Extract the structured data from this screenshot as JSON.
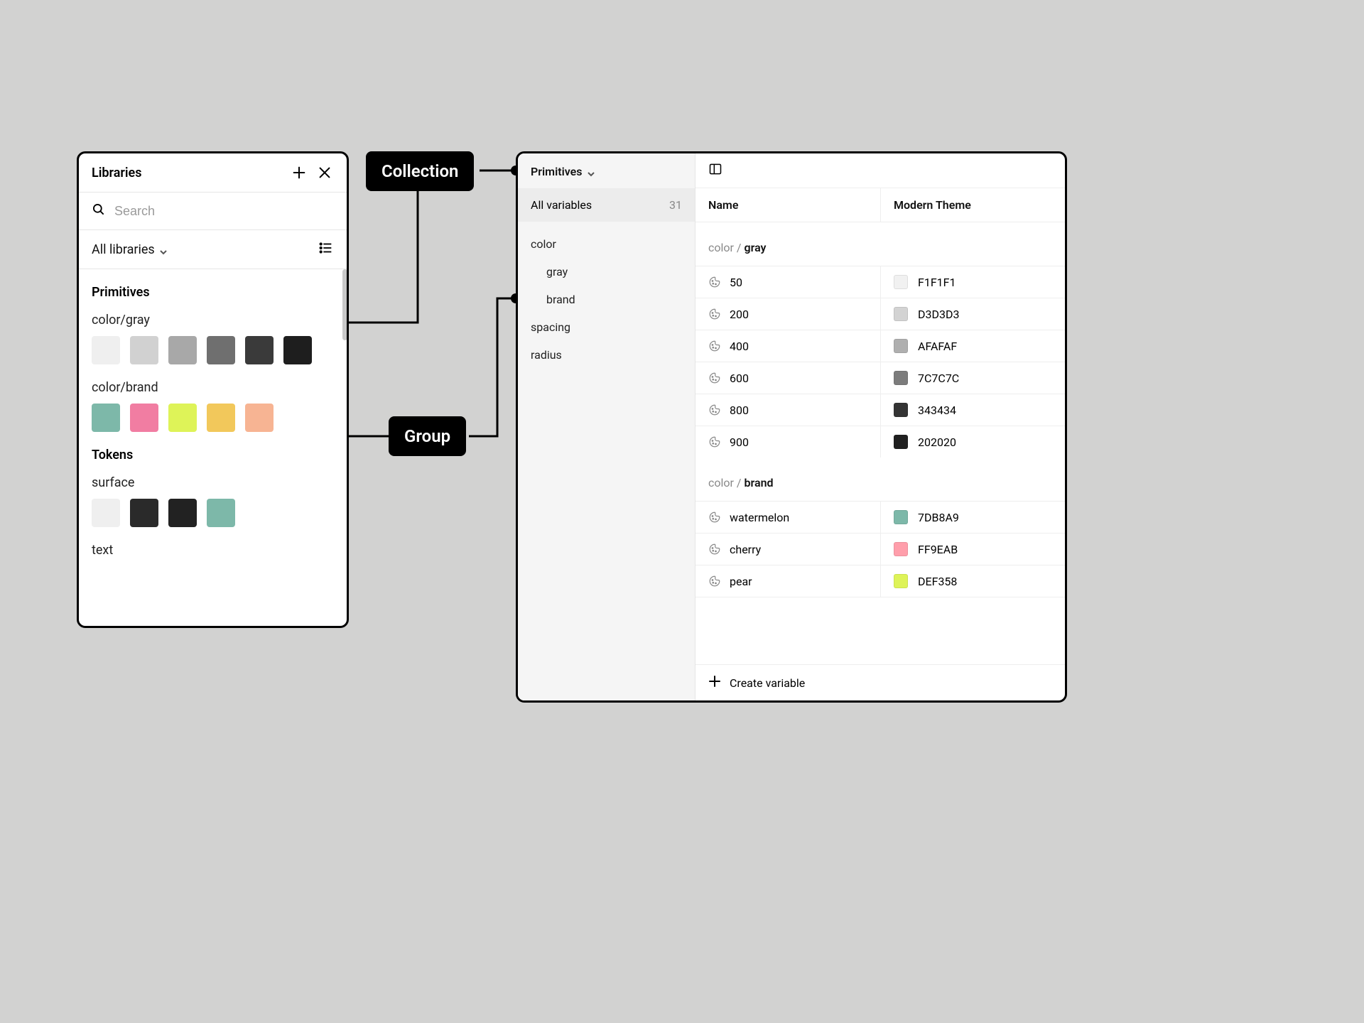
{
  "callouts": {
    "collection": "Collection",
    "group": "Group"
  },
  "libraries": {
    "title": "Libraries",
    "search_placeholder": "Search",
    "filter_label": "All libraries",
    "sections": {
      "primitives": {
        "title": "Primitives",
        "groups": [
          {
            "name": "color/gray",
            "swatches": [
              "#efefef",
              "#d1d1d1",
              "#a8a8a8",
              "#6f6f6f",
              "#3a3a3a",
              "#1e1e1e"
            ]
          },
          {
            "name": "color/brand",
            "swatches": [
              "#7db8a9",
              "#f17da2",
              "#def358",
              "#f2c85b",
              "#f7b493"
            ]
          }
        ]
      },
      "tokens": {
        "title": "Tokens",
        "groups": [
          {
            "name": "surface",
            "swatches": [
              "#efefef",
              "#2a2a2a",
              "#222222",
              "#7db8a9"
            ]
          },
          {
            "name": "text",
            "swatches": []
          }
        ]
      }
    }
  },
  "variables": {
    "collection_name": "Primitives",
    "all_variables_label": "All variables",
    "all_variables_count": "31",
    "tree": [
      {
        "label": "color",
        "children": [
          "gray",
          "brand"
        ]
      },
      {
        "label": "spacing",
        "children": []
      },
      {
        "label": "radius",
        "children": []
      }
    ],
    "columns": {
      "name": "Name",
      "mode": "Modern Theme"
    },
    "groups": [
      {
        "path_prefix": "color / ",
        "path_name": "gray",
        "rows": [
          {
            "name": "50",
            "hex": "F1F1F1",
            "swatch": "#f1f1f1"
          },
          {
            "name": "200",
            "hex": "D3D3D3",
            "swatch": "#d3d3d3"
          },
          {
            "name": "400",
            "hex": "AFAFAF",
            "swatch": "#afafaf"
          },
          {
            "name": "600",
            "hex": "7C7C7C",
            "swatch": "#7c7c7c"
          },
          {
            "name": "800",
            "hex": "343434",
            "swatch": "#343434"
          },
          {
            "name": "900",
            "hex": "202020",
            "swatch": "#202020"
          }
        ]
      },
      {
        "path_prefix": "color / ",
        "path_name": "brand",
        "rows": [
          {
            "name": "watermelon",
            "hex": "7DB8A9",
            "swatch": "#7db8a9"
          },
          {
            "name": "cherry",
            "hex": "FF9EAB",
            "swatch": "#ff9eab"
          },
          {
            "name": "pear",
            "hex": "DEF358",
            "swatch": "#def358"
          }
        ]
      }
    ],
    "create_label": "Create variable"
  }
}
